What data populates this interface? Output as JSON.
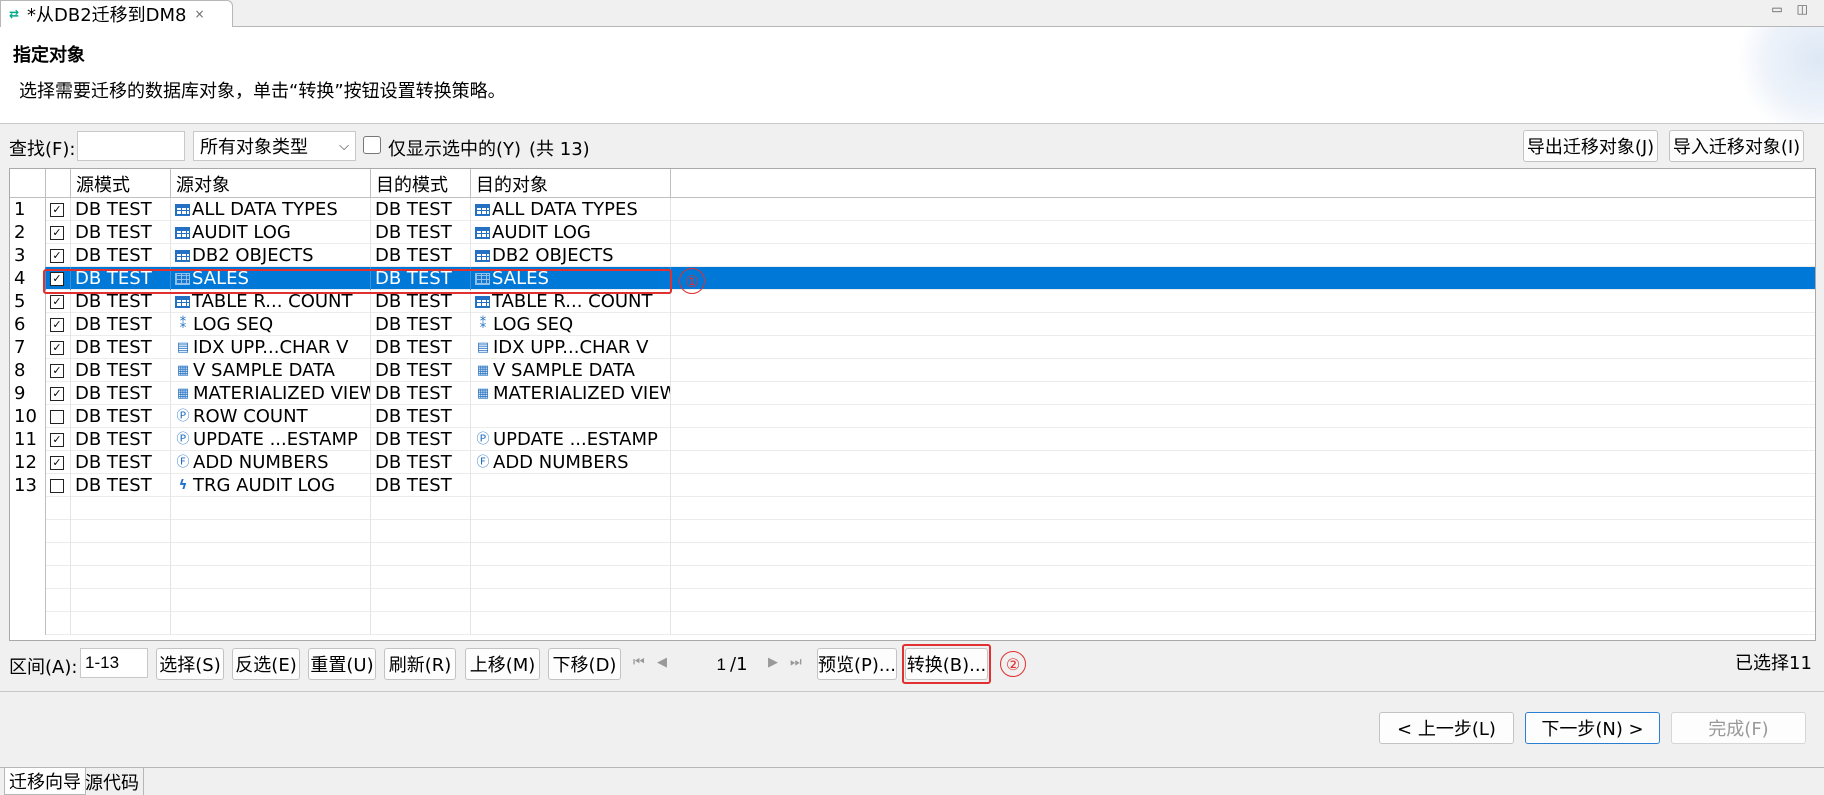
{
  "window": {
    "tab_title": "*从DB2迁移到DM8",
    "close_icon": "×"
  },
  "header": {
    "title": "指定对象",
    "description": "选择需要迁移的数据库对象，单击“转换”按钮设置转换策略。"
  },
  "toolbar": {
    "find_label": "查找(F):",
    "find_value": "",
    "type_filter": "所有对象类型",
    "show_selected_label": "仅显示选中的(Y)",
    "count_text": "(共 13)",
    "export_button": "导出迁移对象(J)",
    "import_button": "导入迁移对象(I)"
  },
  "grid": {
    "columns": [
      "源模式",
      "源对象",
      "目的模式",
      "目的对象"
    ],
    "rows": [
      {
        "num": "1",
        "checked": true,
        "src_schema": "DB TEST",
        "src_icon": "table",
        "src_obj": "ALL DATA TYPES",
        "dst_schema": "DB TEST",
        "dst_icon": "table",
        "dst_obj": "ALL DATA TYPES"
      },
      {
        "num": "2",
        "checked": true,
        "src_schema": "DB TEST",
        "src_icon": "table",
        "src_obj": "AUDIT LOG",
        "dst_schema": "DB TEST",
        "dst_icon": "table",
        "dst_obj": "AUDIT LOG"
      },
      {
        "num": "3",
        "checked": true,
        "src_schema": "DB TEST",
        "src_icon": "table",
        "src_obj": "DB2 OBJECTS",
        "dst_schema": "DB TEST",
        "dst_icon": "table",
        "dst_obj": "DB2 OBJECTS"
      },
      {
        "num": "4",
        "checked": true,
        "src_schema": "DB TEST",
        "src_icon": "table",
        "src_obj": "SALES",
        "dst_schema": "DB TEST",
        "dst_icon": "table",
        "dst_obj": "SALES"
      },
      {
        "num": "5",
        "checked": true,
        "src_schema": "DB TEST",
        "src_icon": "table",
        "src_obj": "TABLE R... COUNT",
        "dst_schema": "DB TEST",
        "dst_icon": "table",
        "dst_obj": "TABLE R... COUNT"
      },
      {
        "num": "6",
        "checked": true,
        "src_schema": "DB TEST",
        "src_icon": "sequence",
        "src_obj": "LOG SEQ",
        "dst_schema": "DB TEST",
        "dst_icon": "sequence",
        "dst_obj": "LOG SEQ"
      },
      {
        "num": "7",
        "checked": true,
        "src_schema": "DB TEST",
        "src_icon": "index",
        "src_obj": "IDX UPP...CHAR V",
        "dst_schema": "DB TEST",
        "dst_icon": "index",
        "dst_obj": "IDX UPP...CHAR V"
      },
      {
        "num": "8",
        "checked": true,
        "src_schema": "DB TEST",
        "src_icon": "view",
        "src_obj": "V SAMPLE DATA",
        "dst_schema": "DB TEST",
        "dst_icon": "view",
        "dst_obj": "V SAMPLE DATA"
      },
      {
        "num": "9",
        "checked": true,
        "src_schema": "DB TEST",
        "src_icon": "view",
        "src_obj": "MATERIALIZED VIEW",
        "dst_schema": "DB TEST",
        "dst_icon": "view",
        "dst_obj": "MATERIALIZED VIEW"
      },
      {
        "num": "10",
        "checked": false,
        "src_schema": "DB TEST",
        "src_icon": "procedure",
        "src_obj": "ROW COUNT",
        "dst_schema": "DB TEST",
        "dst_icon": "",
        "dst_obj": ""
      },
      {
        "num": "11",
        "checked": true,
        "src_schema": "DB TEST",
        "src_icon": "procedure",
        "src_obj": "UPDATE ...ESTAMP",
        "dst_schema": "DB TEST",
        "dst_icon": "procedure",
        "dst_obj": "UPDATE ...ESTAMP"
      },
      {
        "num": "12",
        "checked": true,
        "src_schema": "DB TEST",
        "src_icon": "function",
        "src_obj": "ADD NUMBERS",
        "dst_schema": "DB TEST",
        "dst_icon": "function",
        "dst_obj": "ADD NUMBERS"
      },
      {
        "num": "13",
        "checked": false,
        "src_schema": "DB TEST",
        "src_icon": "trigger",
        "src_obj": "TRG AUDIT LOG",
        "dst_schema": "DB TEST",
        "dst_icon": "",
        "dst_obj": ""
      }
    ],
    "selected_row": "4",
    "annotation_1": "①"
  },
  "bottom": {
    "range_label": "区间(A):",
    "range_value": "1-13",
    "select_button": "选择(S)",
    "invert_button": "反选(E)",
    "reset_button": "重置(U)",
    "refresh_button": "刷新(R)",
    "up_button": "上移(M)",
    "down_button": "下移(D)",
    "page_value": "1",
    "page_total": "/1",
    "preview_button": "预览(P)...",
    "convert_button": "转换(B)...",
    "annotation_2": "②",
    "selected_count": "已选择11"
  },
  "footer": {
    "back_button": "< 上一步(L)",
    "next_button": "下一步(N) >",
    "finish_button": "完成(F)"
  },
  "status_tabs": [
    "迁移向导",
    "源代码"
  ],
  "colors": {
    "selection": "#0078d7",
    "annotation": "#e03030"
  }
}
